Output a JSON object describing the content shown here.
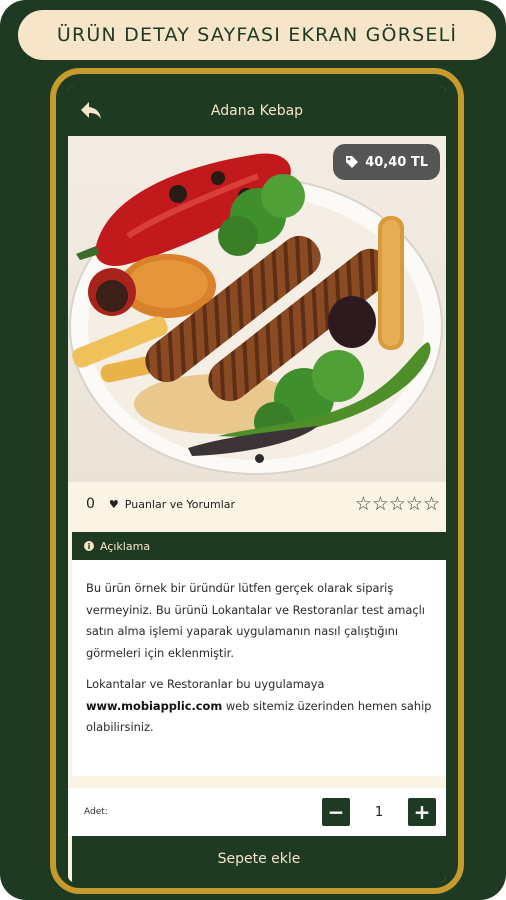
{
  "banner": {
    "title": "ÜRÜN DETAY SAYFASI EKRAN GÖRSELİ"
  },
  "appbar": {
    "title": "Adana Kebap",
    "back_icon": "back-arrow-icon"
  },
  "product": {
    "price": "40,40 TL",
    "price_icon": "tag-icon"
  },
  "ratings": {
    "count": "0",
    "label": "Puanlar ve Yorumlar",
    "heart_icon": "♥",
    "stars": "☆☆☆☆☆"
  },
  "description": {
    "header": "Açıklama",
    "info_icon": "i",
    "paragraph1": "Bu ürün örnek bir üründür lütfen gerçek olarak sipariş vermeyiniz. Bu ürünü Lokantalar ve Restoranlar test amaçlı satın alma işlemi yaparak uygulamanın nasıl çalıştığını görmeleri için eklenmiştir.",
    "paragraph2_before": "Lokantalar ve Restoranlar bu uygulamaya ",
    "paragraph2_link": "www.mobiapplic.com",
    "paragraph2_after": " web sitemiz üzerinden hemen sahip olabilirsiniz."
  },
  "quantity": {
    "label": "Adet:",
    "value": "1",
    "minus": "−",
    "plus": "+"
  },
  "cart": {
    "button_label": "Sepete ekle"
  },
  "colors": {
    "dark_green": "#1f3a23",
    "cream": "#f6e5c8",
    "gold": "#c79a2e",
    "badge_gray": "#555555"
  }
}
